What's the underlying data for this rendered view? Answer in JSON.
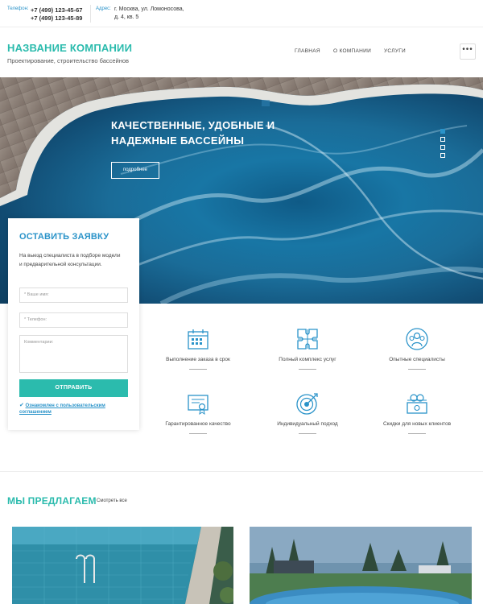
{
  "topbar": {
    "phone_label": "Телефон:",
    "phone_1": "+7 (499) 123-45-67",
    "phone_2": "+7 (499) 123-45-89",
    "address_label": "Адрес:",
    "address_1": "г. Москва, ул. Ломоносова,",
    "address_2": "д. 4, кв. 5"
  },
  "header": {
    "company_name": "НАЗВАНИЕ КОМПАНИИ",
    "company_sub": "Проектирование, строительство бассейнов",
    "nav": [
      "ГЛАВНАЯ",
      "О КОМПАНИИ",
      "УСЛУГИ"
    ],
    "menu_glyph": "•••"
  },
  "hero": {
    "title": "КАЧЕСТВЕННЫЕ, УДОБНЫЕ И НАДЕЖНЫЕ БАССЕЙНЫ",
    "button": "подробнее",
    "slides_total": 4,
    "active_slide": 1
  },
  "form": {
    "title": "ОСТАВИТЬ ЗАЯВКУ",
    "description": "На выезд специалиста в подборе модели и предварительной консультации.",
    "name_placeholder": "* Ваше имя:",
    "phone_placeholder": "* Телефон:",
    "comment_placeholder": "Комментарии:",
    "submit": "ОТПРАВИТЬ",
    "agree_check": "✔",
    "agree_text": "Ознакомлен с пользовательским соглашением"
  },
  "features": [
    {
      "icon": "calendar-icon",
      "text": "Выполнение заказа в срок"
    },
    {
      "icon": "puzzle-icon",
      "text": "Полный комплекс услуг"
    },
    {
      "icon": "team-icon",
      "text": "Опытные специалисты"
    },
    {
      "icon": "certificate-icon",
      "text": "Гарантированное качество"
    },
    {
      "icon": "target-icon",
      "text": "Индивидуальный подход"
    },
    {
      "icon": "money-icon",
      "text": "Скидки для новых клиентов"
    }
  ],
  "offers": {
    "title": "МЫ ПРЕДЛАГАЕМ",
    "view_all": "Смотреть все"
  },
  "colors": {
    "accent_teal": "#2bbbad",
    "accent_blue": "#2a93c9"
  }
}
